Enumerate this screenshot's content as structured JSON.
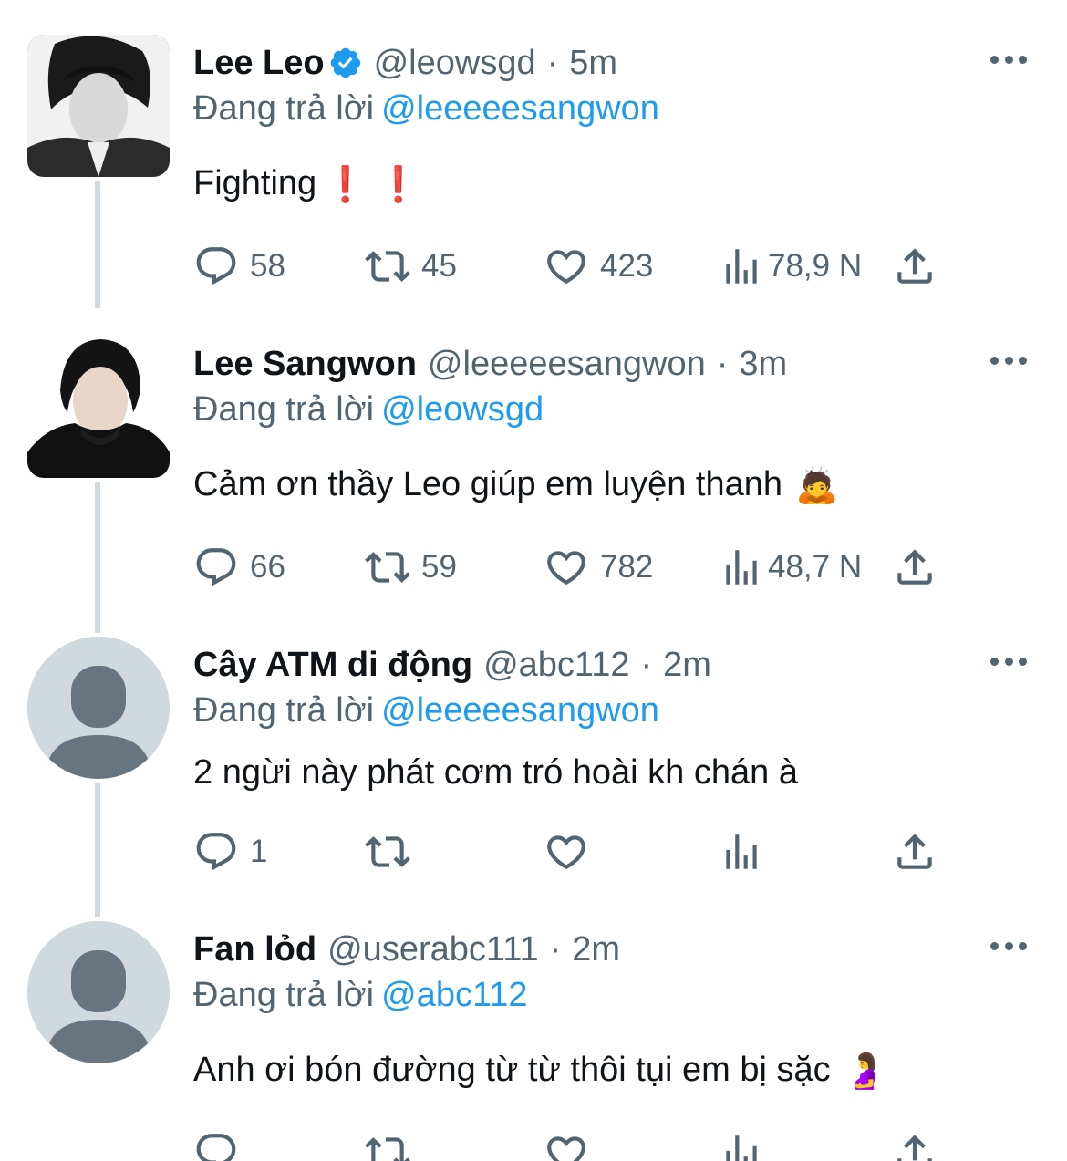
{
  "tweets": [
    {
      "name": "Lee Leo",
      "verified": true,
      "handle": "@leowsgd",
      "dot": "·",
      "time": "5m",
      "reply_prefix": "Đang trả lời",
      "reply_mention": "@leeeeesangwon",
      "text": "Fighting",
      "text_emoji": "❗️ ❗️",
      "avatar_type": "photo",
      "actions": {
        "replies": "58",
        "retweets": "45",
        "likes": "423",
        "views": "78,9 N"
      }
    },
    {
      "name": "Lee Sangwon",
      "verified": false,
      "handle": "@leeeeesangwon",
      "dot": "·",
      "time": "3m",
      "reply_prefix": "Đang trả lời",
      "reply_mention": "@leowsgd",
      "text": "Cảm ơn thầy Leo giúp em luyện thanh",
      "text_emoji": "🙇",
      "avatar_type": "photo",
      "actions": {
        "replies": "66",
        "retweets": "59",
        "likes": "782",
        "views": "48,7 N"
      }
    },
    {
      "name": "Cây ATM di động",
      "verified": false,
      "handle": "@abc112",
      "dot": "·",
      "time": "2m",
      "reply_prefix": "Đang trả lời",
      "reply_mention": "@leeeeesangwon",
      "text": "2 ngừi này phát cơm tró hoài kh chán à",
      "text_emoji": "",
      "avatar_type": "default",
      "actions": {
        "replies": "1",
        "retweets": "",
        "likes": "",
        "views": ""
      }
    },
    {
      "name": "Fan lỏd",
      "verified": false,
      "handle": "@userabc111",
      "dot": "·",
      "time": "2m",
      "reply_prefix": "Đang trả lời",
      "reply_mention": "@abc112",
      "text": "Anh ơi bón đường từ từ thôi tụi em bị sặc",
      "text_emoji": "🤰",
      "avatar_type": "default",
      "actions": {
        "replies": "",
        "retweets": "",
        "likes": "",
        "views": ""
      }
    }
  ],
  "icons": {
    "reply": "reply-icon",
    "retweet": "retweet-icon",
    "like": "heart-icon",
    "views": "views-icon",
    "share": "share-icon",
    "more": "more-icon",
    "verified": "verified-badge-icon"
  },
  "colors": {
    "text": "#0f1419",
    "secondary": "#536471",
    "link": "#1d9bf0",
    "thread_line": "#cfd9de",
    "exclamation": "#e0245e"
  }
}
